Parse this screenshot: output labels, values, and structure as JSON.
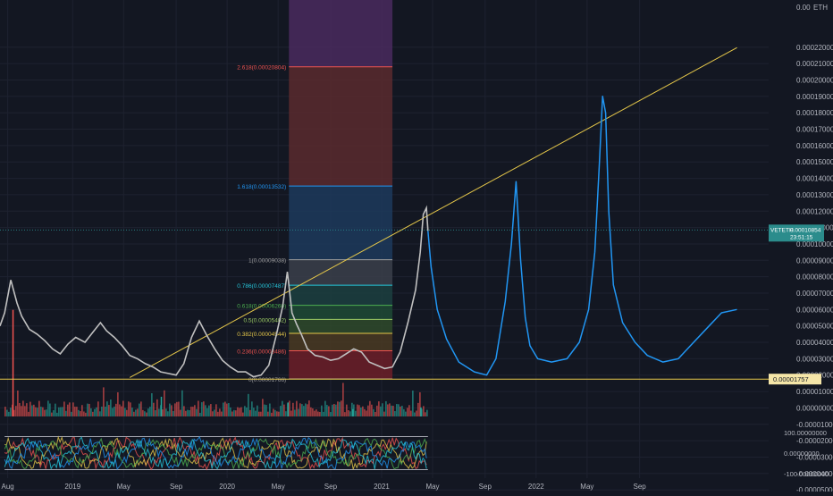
{
  "colors": {
    "background": "#131722",
    "grid": "#1e2230",
    "axis_text": "#b2b5be",
    "price_line": "#c0c0c0",
    "projection": "#2196f3",
    "trendline": "#e6c84a",
    "volume_up": "#26a69a",
    "volume_down": "#ef5350",
    "last_price_tag": "#2b8c8c",
    "level_tag": "#f5e6a8",
    "osc_bands": [
      "#ef5350",
      "#e6c84a",
      "#4caf50",
      "#2196f3",
      "#26c6da"
    ]
  },
  "chart_data": {
    "type": "line",
    "title": "",
    "currency": "ETH",
    "y_scale_top_label": "0.00",
    "y_ticks": [
      "0.00022000",
      "0.00021000",
      "0.00020000",
      "0.00019000",
      "0.00018000",
      "0.00017000",
      "0.00016000",
      "0.00015000",
      "0.00014000",
      "0.00013000",
      "0.00012000",
      "0.00011000",
      "0.00010000",
      "0.00009000",
      "0.00008000",
      "0.00007000",
      "0.00006000",
      "0.00005000",
      "0.00004000",
      "0.00003000",
      "0.00002000",
      "0.00001000",
      "0.00000000",
      "-0.00001000",
      "-0.00002000",
      "-0.00003000",
      "-0.00004000",
      "-0.00005000"
    ],
    "x_ticks": [
      "Aug",
      "2019",
      "May",
      "Sep",
      "2020",
      "May",
      "Sep",
      "2021",
      "May",
      "Sep",
      "2022",
      "May",
      "Sep"
    ],
    "x_tick_pos": [
      2018.58,
      2019.0,
      2019.33,
      2019.67,
      2020.0,
      2020.33,
      2020.67,
      2021.0,
      2021.33,
      2021.67,
      2022.0,
      2022.33,
      2022.67
    ],
    "x_range": [
      2018.53,
      2023.32
    ],
    "y_range": [
      -7.4e-06,
      0.0002357
    ],
    "osc_range": [
      -100,
      100
    ],
    "osc_ticks": [
      "100.00000000",
      "0.00000000",
      "-100.00000000"
    ],
    "last_price": {
      "symbol": "VETETH",
      "value": "0.00010854",
      "countdown": "23:51:15",
      "y": 0.00010854
    },
    "support_level": {
      "value": "0.00001757",
      "y": 1.757e-05
    },
    "price_series": {
      "x": [
        2018.53,
        2018.56,
        2018.6,
        2018.64,
        2018.67,
        2018.72,
        2018.77,
        2018.82,
        2018.87,
        2018.92,
        2018.97,
        2019.02,
        2019.08,
        2019.13,
        2019.18,
        2019.22,
        2019.27,
        2019.32,
        2019.37,
        2019.42,
        2019.47,
        2019.52,
        2019.57,
        2019.62,
        2019.67,
        2019.72,
        2019.77,
        2019.82,
        2019.87,
        2019.92,
        2019.97,
        2020.02,
        2020.07,
        2020.12,
        2020.17,
        2020.22,
        2020.27,
        2020.32,
        2020.36,
        2020.39,
        2020.42,
        2020.45,
        2020.48,
        2020.52,
        2020.57,
        2020.62,
        2020.67,
        2020.72,
        2020.77,
        2020.82,
        2020.87,
        2020.92,
        2020.97,
        2021.02,
        2021.07,
        2021.12,
        2021.17,
        2021.22,
        2021.25,
        2021.27,
        2021.29,
        2021.3
      ],
      "y": [
        5e-05,
        5.8e-05,
        7.8e-05,
        6.4e-05,
        5.6e-05,
        4.8e-05,
        4.5e-05,
        4.1e-05,
        3.6e-05,
        3.3e-05,
        3.9e-05,
        4.3e-05,
        4e-05,
        4.6e-05,
        5.2e-05,
        4.7e-05,
        4.3e-05,
        3.8e-05,
        3.2e-05,
        3e-05,
        2.7e-05,
        2.5e-05,
        2.2e-05,
        2.1e-05,
        2e-05,
        2.7e-05,
        4.3e-05,
        5.3e-05,
        4.4e-05,
        3.6e-05,
        2.9e-05,
        2.5e-05,
        2.2e-05,
        2.2e-05,
        1.9e-05,
        2e-05,
        2.6e-05,
        4.5e-05,
        6.2e-05,
        8.3e-05,
        5.8e-05,
        5.1e-05,
        4.5e-05,
        3.6e-05,
        3.2e-05,
        3.1e-05,
        2.9e-05,
        3e-05,
        3.3e-05,
        3.6e-05,
        3.4e-05,
        2.8e-05,
        2.6e-05,
        2.4e-05,
        2.5e-05,
        3.4e-05,
        5.2e-05,
        7.2e-05,
        9.5e-05,
        0.000118,
        0.000122,
        0.000108
      ]
    },
    "projection_series": {
      "x": [
        2021.3,
        2021.32,
        2021.36,
        2021.42,
        2021.5,
        2021.6,
        2021.68,
        2021.74,
        2021.8,
        2021.84,
        2021.87,
        2021.9,
        2021.93,
        2021.96,
        2022.01,
        2022.1,
        2022.2,
        2022.28,
        2022.34,
        2022.38,
        2022.41,
        2022.43,
        2022.45,
        2022.47,
        2022.5,
        2022.56,
        2022.64,
        2022.72,
        2022.82,
        2022.92,
        2023.02,
        2023.12,
        2023.2,
        2023.3
      ],
      "y": [
        0.000108,
        8.6e-05,
        6e-05,
        4.2e-05,
        2.8e-05,
        2.2e-05,
        2e-05,
        3e-05,
        6.5e-05,
        0.0001,
        0.000138,
        9e-05,
        5.5e-05,
        3.8e-05,
        3e-05,
        2.8e-05,
        3e-05,
        4e-05,
        6e-05,
        9.5e-05,
        0.00015,
        0.00019,
        0.00018,
        0.00012,
        7.5e-05,
        5.2e-05,
        4e-05,
        3.2e-05,
        2.8e-05,
        3e-05,
        4e-05,
        5e-05,
        5.8e-05,
        6e-05
      ]
    },
    "trendline": {
      "x": [
        2019.37,
        2023.3
      ],
      "y": [
        1.85e-05,
        0.0002197
      ]
    },
    "support_line_y": 1.757e-05,
    "fib_zone": {
      "x0": 2020.4,
      "x1": 2021.07
    },
    "fib_levels": [
      {
        "label": "0(0.00001766)",
        "value": 1.766e-05,
        "color": "#9e9e9e",
        "fill": "#6d1f28"
      },
      {
        "label": "0.236(0.00003486)",
        "value": 3.486e-05,
        "color": "#ef5350",
        "fill": "#4a3a22"
      },
      {
        "label": "0.382(0.00004544)",
        "value": 4.544e-05,
        "color": "#e6c84a",
        "fill": "#2f4a2a"
      },
      {
        "label": "0.5(0.00005402)",
        "value": 5.402e-05,
        "color": "#9ccc65",
        "fill": "#1f4a35"
      },
      {
        "label": "0.618(0.00006260)",
        "value": 6.26e-05,
        "color": "#4caf50",
        "fill": "#1c4040"
      },
      {
        "label": "0.786(0.00007487)",
        "value": 7.487e-05,
        "color": "#26c6da",
        "fill": "#3b3f4a"
      },
      {
        "label": "1(0.00009038)",
        "value": 9.038e-05,
        "color": "#9e9e9e",
        "fill": "#1d3a5c"
      },
      {
        "label": "1.618(0.00013532)",
        "value": 0.00013532,
        "color": "#2196f3",
        "fill": "#5a2a2e"
      },
      {
        "label": "2.618(0.00020804)",
        "value": 0.00020804,
        "color": "#ef5350",
        "fill": "#4a2a5e"
      }
    ],
    "volume": {
      "baseline_y": -5.2e-06,
      "spikes": [
        {
          "x": 2018.61,
          "height": 6.5e-05,
          "color": "#ef5350"
        },
        {
          "x": 2019.57,
          "height": 1.2e-05,
          "color": "#26a69a"
        },
        {
          "x": 2020.39,
          "height": 8.5e-06,
          "color": "#26a69a"
        },
        {
          "x": 2020.81,
          "height": 4.5e-06,
          "color": "#26a69a"
        },
        {
          "x": 2021.25,
          "height": 5.5e-06,
          "color": "#26a69a"
        }
      ]
    }
  }
}
